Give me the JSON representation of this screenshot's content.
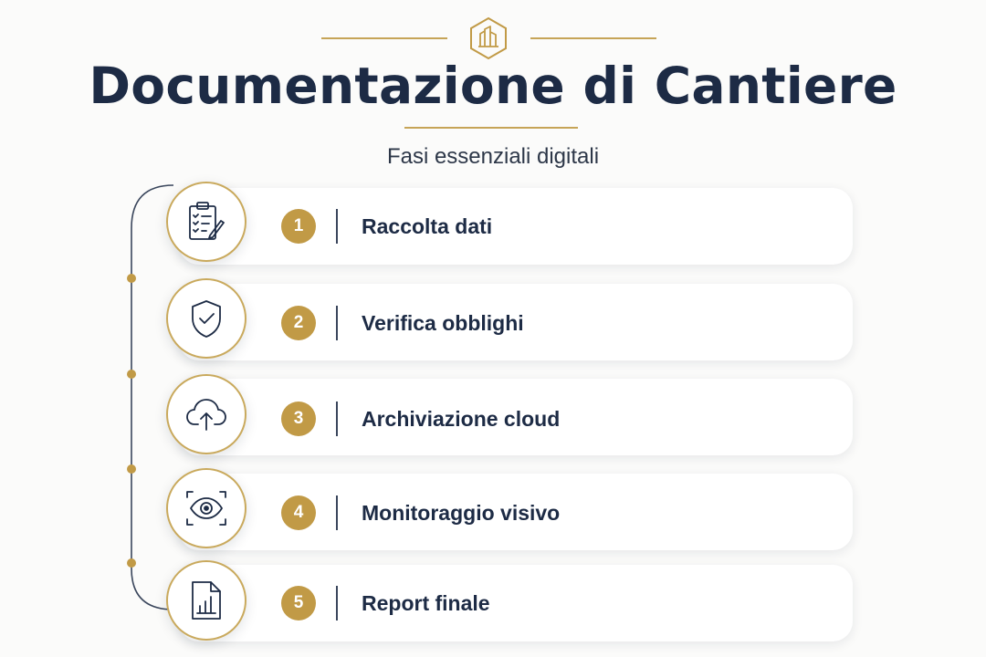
{
  "header": {
    "title": "Documentazione di Cantiere",
    "subtitle": "Fasi essenziali digitali",
    "logo_icon": "building-icon"
  },
  "colors": {
    "accent_gold": "#c19a46",
    "navy": "#1d2b45"
  },
  "steps": [
    {
      "number": "1",
      "label": "Raccolta dati",
      "icon": "clipboard-checklist-icon"
    },
    {
      "number": "2",
      "label": "Verifica obblighi",
      "icon": "shield-check-icon"
    },
    {
      "number": "3",
      "label": "Archiviazione cloud",
      "icon": "cloud-upload-icon"
    },
    {
      "number": "4",
      "label": "Monitoraggio visivo",
      "icon": "eye-scan-icon"
    },
    {
      "number": "5",
      "label": "Report finale",
      "icon": "report-chart-icon"
    }
  ]
}
